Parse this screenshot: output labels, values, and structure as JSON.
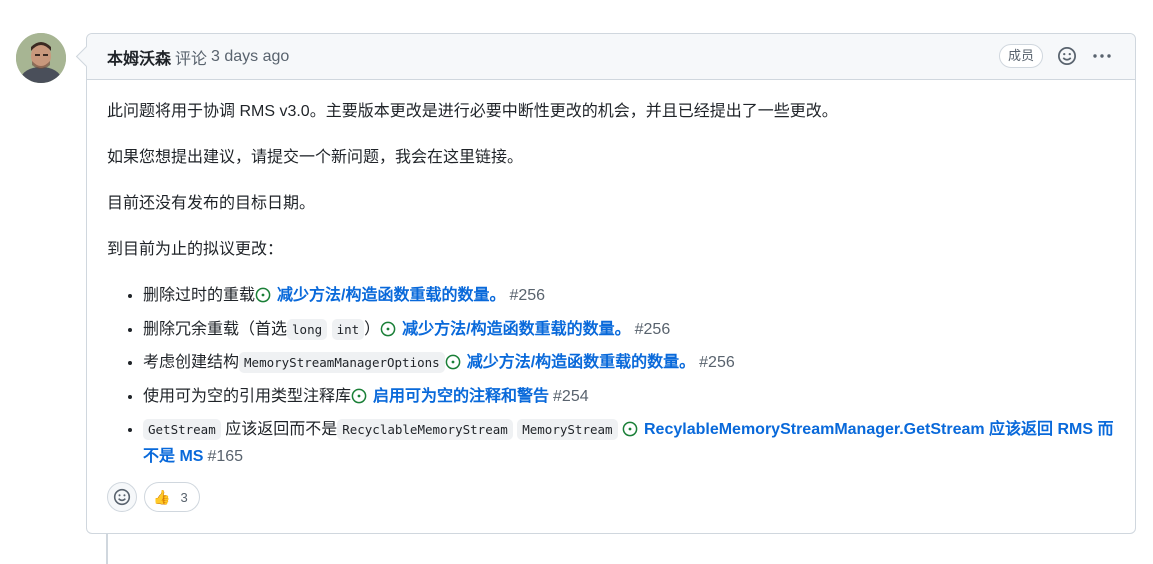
{
  "comment": {
    "author": "本姆沃森",
    "action": "评论",
    "time": "3 days ago",
    "badge": "成员",
    "paragraphs": [
      "此问题将用于协调 RMS v3.0。主要版本更改是进行必要中断性更改的机会，并且已经提出了一些更改。",
      "如果您想提出建议，请提交一个新问题，我会在这里链接。",
      "目前还没有发布的目标日期。",
      "到目前为止的拟议更改："
    ],
    "items": [
      {
        "pre": "删除过时的重载",
        "link": "减少方法/构造函数重载的数量。",
        "num": "#256"
      },
      {
        "pre": "删除冗余重载（首选",
        "code1": "long",
        "code2": "int",
        "post": "）",
        "link": "减少方法/构造函数重载的数量。",
        "num": "#256"
      },
      {
        "pre": "考虑创建结构",
        "code1": "MemoryStreamManagerOptions",
        "link": "减少方法/构造函数重载的数量。",
        "num": "#256"
      },
      {
        "pre": "使用可为空的引用类型注释库",
        "link": "启用可为空的注释和警告",
        "num": "#254"
      },
      {
        "code1": "GetStream",
        "mid": "应该返回而不是",
        "code2": "RecyclableMemoryStream",
        "code3": "MemoryStream",
        "link": "RecylableMemoryStreamManager.GetStream 应该返回 RMS 而不是 MS",
        "num": "#165"
      }
    ],
    "reactions": {
      "thumbs_up": "3",
      "thumbs_emoji": "👍"
    }
  },
  "icons": {
    "smiley": "smiley-icon",
    "more": "kebab-horizontal-icon",
    "issue_open": "issue-opened-icon"
  },
  "colors": {
    "link": "#0969da",
    "issue_open": "#1a7f37",
    "border": "#d0d7de",
    "header_bg": "#f6f8fa"
  }
}
